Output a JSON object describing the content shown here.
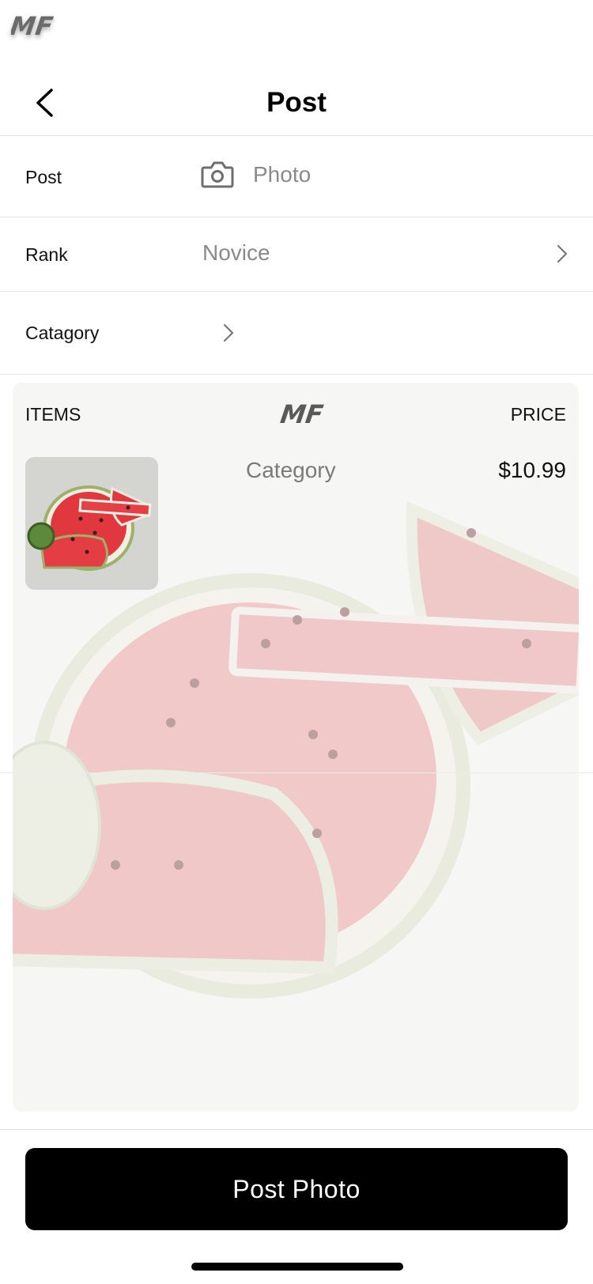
{
  "header": {
    "logo_text": "MF",
    "title": "Post"
  },
  "rows": {
    "post": {
      "label": "Post",
      "value": "Photo",
      "icon": "camera-icon"
    },
    "rank": {
      "label": "Rank",
      "value": "Novice",
      "icon": "chevron-right-icon"
    },
    "category": {
      "label": "Catagory",
      "icon": "chevron-right-icon"
    }
  },
  "card": {
    "items_label": "ITEMS",
    "price_label": "PRICE",
    "logo_text": "MF",
    "item": {
      "category": "Category",
      "price": "$10.99",
      "image": "watermelon-slices"
    }
  },
  "footer": {
    "post_button": "Post Photo"
  },
  "colors": {
    "accent": "#000000",
    "muted_text": "#8a8a8a",
    "card_bg": "#f6f6f5"
  }
}
